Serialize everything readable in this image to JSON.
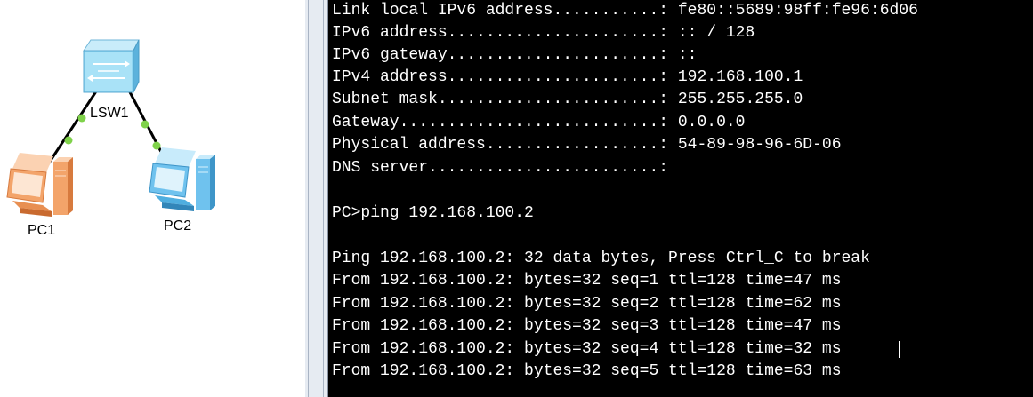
{
  "topology": {
    "devices": [
      {
        "id": "LSW1",
        "label": "LSW1",
        "kind": "switch-icon"
      },
      {
        "id": "PC1",
        "label": "PC1",
        "kind": "pc-icon",
        "color": "#f3a46a"
      },
      {
        "id": "PC2",
        "label": "PC2",
        "kind": "pc-icon",
        "color": "#6fc2ee"
      }
    ],
    "link_color": "#000000",
    "port_status_color": "#7fd24a",
    "switch_color": "#8fd6f2"
  },
  "console": {
    "background": "#000000",
    "foreground": "#ffffff",
    "lines": [
      "Link local IPv6 address...........: fe80::5689:98ff:fe96:6d06",
      "IPv6 address......................: :: / 128",
      "IPv6 gateway......................: ::",
      "IPv4 address......................: 192.168.100.1",
      "Subnet mask.......................: 255.255.255.0",
      "Gateway...........................: 0.0.0.0",
      "Physical address..................: 54-89-98-96-6D-06",
      "DNS server........................:",
      "",
      "PC>ping 192.168.100.2",
      "",
      "Ping 192.168.100.2: 32 data bytes, Press Ctrl_C to break",
      "From 192.168.100.2: bytes=32 seq=1 ttl=128 time=47 ms",
      "From 192.168.100.2: bytes=32 seq=2 ttl=128 time=62 ms",
      "From 192.168.100.2: bytes=32 seq=3 ttl=128 time=47 ms",
      "From 192.168.100.2: bytes=32 seq=4 ttl=128 time=32 ms",
      "From 192.168.100.2: bytes=32 seq=5 ttl=128 time=63 ms"
    ]
  }
}
